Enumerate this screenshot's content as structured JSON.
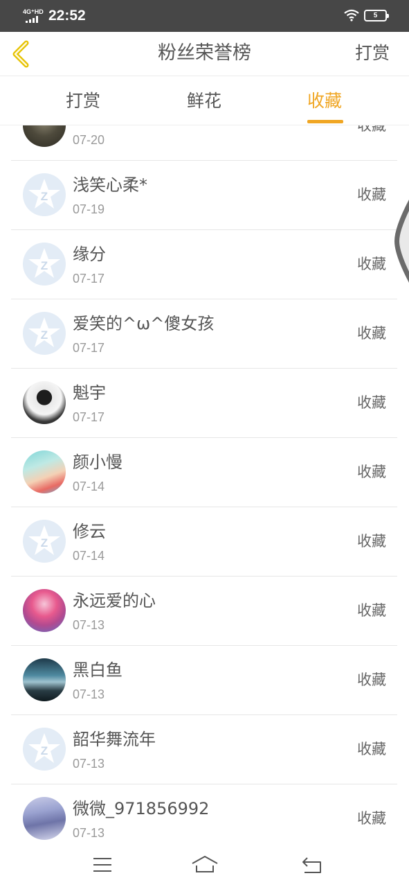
{
  "status_bar": {
    "network": "4G⁺HD",
    "time": "22:52",
    "battery": "5"
  },
  "header": {
    "title": "粉丝荣誉榜",
    "right_link": "打赏",
    "back_icon": "chevron-left-icon"
  },
  "tabs": [
    {
      "label": "打赏",
      "active": false
    },
    {
      "label": "鲜花",
      "active": false
    },
    {
      "label": "收藏",
      "active": true
    }
  ],
  "accent_color": "#f0a623",
  "list": {
    "items": [
      {
        "name": "",
        "date": "07-20",
        "action": "收藏",
        "avatar": "photo-dark"
      },
      {
        "name": "浅笑心柔*",
        "date": "07-19",
        "action": "收藏",
        "avatar": "default-qq-icon"
      },
      {
        "name": "缘分",
        "date": "07-17",
        "action": "收藏",
        "avatar": "default-qq-icon"
      },
      {
        "name": "爱笑的^ω^傻女孩",
        "date": "07-17",
        "action": "收藏",
        "avatar": "default-qq-icon"
      },
      {
        "name": "魁宇",
        "date": "07-17",
        "action": "收藏",
        "avatar": "photo-bw"
      },
      {
        "name": "颜小慢",
        "date": "07-14",
        "action": "收藏",
        "avatar": "photo-cartoon"
      },
      {
        "name": "修云",
        "date": "07-14",
        "action": "收藏",
        "avatar": "default-qq-icon"
      },
      {
        "name": "永远爱的心",
        "date": "07-13",
        "action": "收藏",
        "avatar": "photo-anime-pink"
      },
      {
        "name": "黑白鱼",
        "date": "07-13",
        "action": "收藏",
        "avatar": "photo-scenery"
      },
      {
        "name": "韶华舞流年",
        "date": "07-13",
        "action": "收藏",
        "avatar": "default-qq-icon"
      },
      {
        "name": "微微_971856992",
        "date": "07-13",
        "action": "收藏",
        "avatar": "photo-girl"
      }
    ]
  },
  "nav_bar": {
    "icons": [
      "menu-icon",
      "home-icon",
      "back-icon"
    ]
  }
}
